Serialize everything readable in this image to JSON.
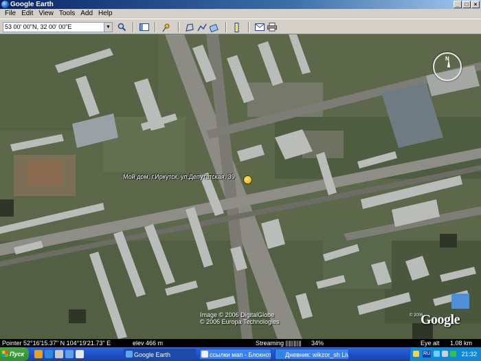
{
  "window": {
    "title": "Google Earth",
    "buttons": [
      "_",
      "□",
      "×"
    ]
  },
  "menu": [
    "File",
    "Edit",
    "View",
    "Tools",
    "Add",
    "Help"
  ],
  "toolbar": {
    "search_value": "53 00' 00\"N, 32 00' 00\"E"
  },
  "map": {
    "placemark_label": "Мой дом, г.Иркутск, ул.Депутатская, 39",
    "compass_label": "N",
    "copyright_lines": [
      "Image © 2006 DigitalGlobe",
      "© 2006 Europa Technologies"
    ],
    "logo_year": "© 2006",
    "logo": "Google"
  },
  "status": {
    "pointer": "Pointer  52°16'15.37\" N  104°19'21.73\" E",
    "elev": "elev  466 m",
    "streaming": "Streaming ||||||||||",
    "percent": "34%",
    "eye_alt_label": "Eye alt",
    "eye_alt_value": "1.08 km"
  },
  "taskbar": {
    "start_label": "Пуск",
    "tasks": [
      {
        "label": "Google Earth",
        "active": true
      },
      {
        "label": "ссылки мап - Блокнот",
        "active": false
      },
      {
        "label": "Дневник: wikzor_sh LiveI...",
        "active": false
      }
    ],
    "lang": "RU",
    "clock": "21:32"
  }
}
